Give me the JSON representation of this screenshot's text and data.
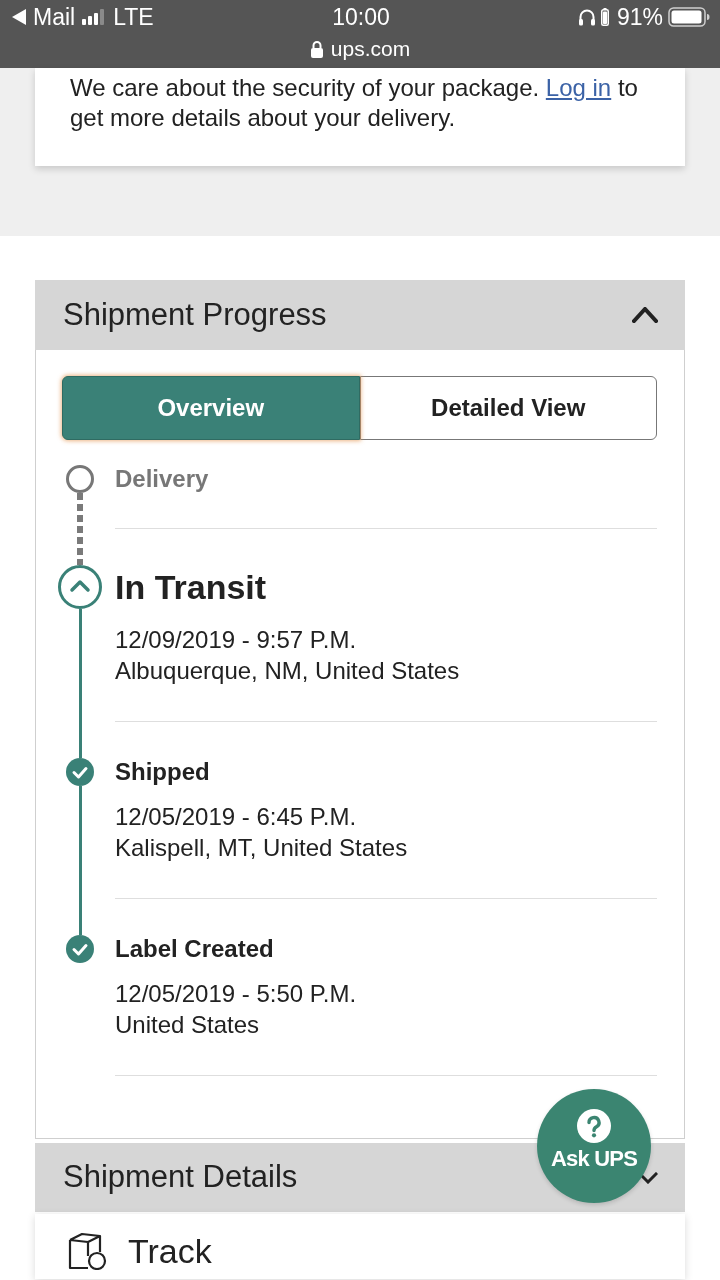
{
  "status_bar": {
    "back_label": "Mail",
    "network": "LTE",
    "time": "10:00",
    "battery": "91%",
    "url": "ups.com"
  },
  "notice": {
    "text_before": "We care about the security of your package.",
    "link": "Log in",
    "text_after": "to get more details about your delivery."
  },
  "progress_panel": {
    "title": "Shipment Progress",
    "expanded": true,
    "tabs": [
      {
        "label": "Overview",
        "selected": true
      },
      {
        "label": "Detailed View",
        "selected": false
      }
    ],
    "events": [
      {
        "kind": "pending",
        "title": "Delivery"
      },
      {
        "kind": "current",
        "title": "In Transit",
        "datetime": "12/09/2019 - 9:57 P.M.",
        "location": "Albuquerque, NM, United States"
      },
      {
        "kind": "done",
        "title": "Shipped",
        "datetime": "12/05/2019 - 6:45 P.M.",
        "location": "Kalispell, MT, United States"
      },
      {
        "kind": "done",
        "title": "Label Created",
        "datetime": "12/05/2019 - 5:50 P.M.",
        "location": "United States"
      }
    ]
  },
  "details_panel": {
    "title": "Shipment Details",
    "expanded": false
  },
  "track_card": {
    "title": "Track"
  },
  "help_button": {
    "label": "Ask UPS"
  }
}
